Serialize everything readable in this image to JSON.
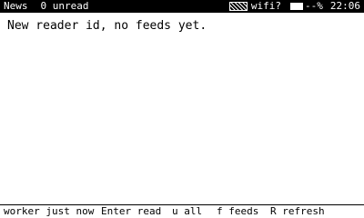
{
  "status_bar": {
    "app_name": "News",
    "unread": "0 unread",
    "signal_icon": "signal-icon",
    "wifi": "wifi?",
    "battery_icon": "battery-icon",
    "battery_pct": "--%",
    "time": "22:06"
  },
  "main": {
    "message": "New reader id, no feeds yet."
  },
  "footer": {
    "worker_status": "worker just now",
    "enter_hint": "Enter read",
    "u_hint": "u all",
    "f_hint": "f feeds",
    "r_hint": "R refresh"
  }
}
